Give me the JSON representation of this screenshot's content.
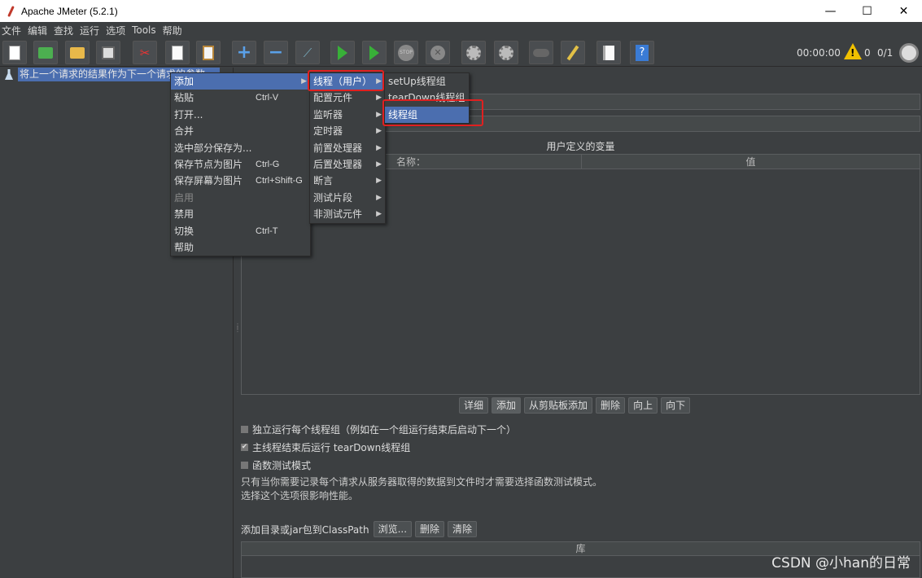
{
  "window": {
    "title": "Apache JMeter (5.2.1)",
    "minimize": "—",
    "maximize": "☐",
    "close": "✕"
  },
  "menubar": [
    "文件",
    "编辑",
    "查找",
    "运行",
    "选项",
    "Tools",
    "帮助"
  ],
  "toolbar": {
    "icons": [
      "new-icon",
      "templates-icon",
      "open-icon",
      "save-icon",
      "cut-icon",
      "copy-icon",
      "paste-icon",
      "expand-icon",
      "collapse-icon",
      "toggle-icon",
      "start-icon",
      "start-no-pause-icon",
      "stop-icon",
      "shutdown-icon",
      "clear-icon",
      "clear-all-icon",
      "search-icon",
      "reset-search-icon",
      "function-helper-icon",
      "help-icon"
    ],
    "plus": "+",
    "minus": "−",
    "stop_text": "STOP",
    "x_text": "✕",
    "help_text": "?"
  },
  "status": {
    "timer": "00:00:00",
    "warnings": "0",
    "threads": "0/1"
  },
  "tree": {
    "root_label": "将上一个请求的结果作为下一个请求的参数"
  },
  "context_menu": {
    "items": [
      {
        "label": "添加",
        "shortcut": "",
        "submenu": true,
        "selected": true
      },
      {
        "label": "粘贴",
        "shortcut": "Ctrl-V"
      },
      {
        "label": "打开..."
      },
      {
        "label": "合并"
      },
      {
        "label": "选中部分保存为..."
      },
      {
        "label": "保存节点为图片",
        "shortcut": "Ctrl-G"
      },
      {
        "label": "保存屏幕为图片",
        "shortcut": "Ctrl+Shift-G"
      },
      {
        "label": "启用",
        "disabled": true
      },
      {
        "label": "禁用"
      },
      {
        "label": "切换",
        "shortcut": "Ctrl-T"
      },
      {
        "label": "帮助"
      }
    ],
    "arrow": "▶"
  },
  "add_submenu": {
    "items": [
      "线程（用户）",
      "配置元件",
      "监听器",
      "定时器",
      "前置处理器",
      "后置处理器",
      "断言",
      "测试片段",
      "非测试元件"
    ]
  },
  "threads_submenu": {
    "items": [
      "setUp线程组",
      "tearDown线程组",
      "线程组"
    ]
  },
  "right_panel": {
    "vars_title": "用户定义的变量",
    "col_name": "名称：",
    "col_value": "值",
    "buttons": [
      "详细",
      "添加",
      "从剪贴板添加",
      "删除",
      "向上",
      "向下"
    ],
    "opt_run_each": "独立运行每个线程组（例如在一个组运行结束后启动下一个）",
    "opt_teardown": "主线程结束后运行 tearDown线程组",
    "opt_functional": "函数测试模式",
    "opt_teardown_checked": true,
    "note_line1": "只有当你需要记录每个请求从服务器取得的数据到文件时才需要选择函数测试模式。",
    "note_line2": "选择这个选项很影响性能。",
    "classpath_label": "添加目录或jar包到ClassPath",
    "browse": "浏览...",
    "delete": "删除",
    "clear": "清除",
    "lib_header": "库",
    "check_mark": "✔"
  },
  "watermark": "CSDN @小han的日常"
}
